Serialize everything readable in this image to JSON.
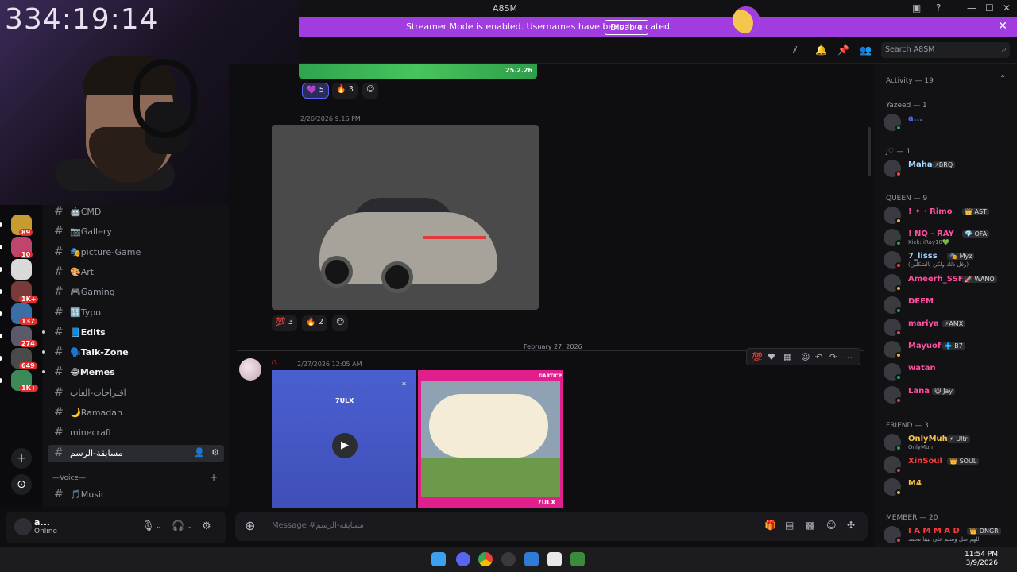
{
  "window": {
    "title": "A8SM",
    "controls": [
      "—",
      "☐",
      "✕"
    ]
  },
  "banner": {
    "text": "Streamer Mode is enabled. Usernames have been truncated.",
    "button": "Disable",
    "close": "✕"
  },
  "webcam": {
    "timer": "334:19:14"
  },
  "servers": [
    {
      "badge": "89",
      "color": "#c89a32"
    },
    {
      "badge": "10",
      "color": "#c1446c"
    },
    {
      "badge": "",
      "color": "#d9d9d9"
    },
    {
      "badge": "1K+",
      "color": "#7a3a3a"
    },
    {
      "badge": "137",
      "color": "#3a6ea5"
    },
    {
      "badge": "274",
      "color": "#5a5a6a"
    },
    {
      "badge": "649",
      "color": "#4a4a4a"
    },
    {
      "badge": "1K+",
      "color": "#3c8a5a"
    }
  ],
  "server_actions": {
    "add": "+",
    "discover": "⊙"
  },
  "channels": [
    {
      "name": "CMD",
      "emoji": "🤖",
      "bold": false
    },
    {
      "name": "Gallery",
      "emoji": "📷",
      "bold": false
    },
    {
      "name": "picture-Game",
      "emoji": "🎭",
      "bold": false
    },
    {
      "name": "Art",
      "emoji": "🎨",
      "bold": false
    },
    {
      "name": "Gaming",
      "emoji": "🎮",
      "bold": false
    },
    {
      "name": "Typo",
      "emoji": "🔢",
      "bold": false
    },
    {
      "name": "Edits",
      "emoji": "📘",
      "bold": true
    },
    {
      "name": "Talk-Zone",
      "emoji": "🗣️",
      "bold": true
    },
    {
      "name": "Memes",
      "emoji": "😂",
      "bold": true
    },
    {
      "name": "اقتراحات-العاب",
      "emoji": "",
      "bold": false
    },
    {
      "name": "Ramadan",
      "emoji": "🌙",
      "bold": false
    },
    {
      "name": "minecraft",
      "emoji": "",
      "bold": false
    },
    {
      "name": "مسابقة-الرسم",
      "emoji": "",
      "bold": false,
      "active": true
    }
  ],
  "voice_category": "—Voice—",
  "voice_channels": [
    {
      "name": "Music",
      "emoji": "🎵"
    }
  ],
  "user": {
    "name": "a...",
    "status": "Online"
  },
  "header": {
    "search_placeholder": "Search A8SM"
  },
  "messages": {
    "strip_date": "25.2.26",
    "reactions_top": [
      {
        "emoji": "💜",
        "count": "5"
      },
      {
        "emoji": "🔥",
        "count": "3"
      }
    ],
    "car_timestamp": "2/26/2026 9:16 PM",
    "reactions_car": [
      {
        "emoji": "💯",
        "count": "3"
      },
      {
        "emoji": "🔥",
        "count": "2"
      }
    ],
    "divider": "February 27, 2026",
    "author": "G...",
    "video_timestamp": "2/27/2026 12:05 AM",
    "video_label_left": "7ULX",
    "video_label_right": "7ULX",
    "video_game_label": "GARTICP"
  },
  "composer": {
    "placeholder": "Message #مسابقة-الرسم"
  },
  "members": {
    "activity": "Activity — 19",
    "sections": [
      {
        "title": "Yazeed — 1",
        "items": [
          {
            "name": "a...",
            "color": "#5865f2",
            "sub": "",
            "tag": ""
          }
        ]
      },
      {
        "title": "J♡ — 1",
        "items": [
          {
            "name": "Maha",
            "color": "#a9d8ff",
            "sub": "",
            "tag": "⚡BRQ"
          }
        ]
      },
      {
        "title": "QUEEN — 9",
        "items": [
          {
            "name": "! ✦ · Rimo",
            "color": "#ff4fa3",
            "sub": "",
            "tag": "👑 AST"
          },
          {
            "name": "! NQ - RAY",
            "color": "#ff4fa3",
            "sub": "Kick: iRay10💚",
            "tag": "💎 OFA"
          },
          {
            "name": "7_lisss",
            "color": "#9ad3ff",
            "sub": "(وقل ذلك ولكن بالشكلين)",
            "tag": "🎭 Myz"
          },
          {
            "name": "Ameerh_SSF",
            "color": "#ff4fa3",
            "sub": "",
            "tag": "🚀 WANO"
          },
          {
            "name": "DEEM",
            "color": "#ff4fa3",
            "sub": "",
            "tag": ""
          },
          {
            "name": "mariya",
            "color": "#ff4fa3",
            "sub": "",
            "tag": "⚡AMX"
          },
          {
            "name": "Mayuof",
            "color": "#ff4fa3",
            "sub": "",
            "tag": "💠 B7"
          },
          {
            "name": "watan",
            "color": "#ff4fa3",
            "sub": "",
            "tag": ""
          },
          {
            "name": "Lana",
            "color": "#ff4fa3",
            "sub": "",
            "tag": "😺 Jay"
          }
        ]
      },
      {
        "title": "FRIEND — 3",
        "items": [
          {
            "name": "OnlyMuh",
            "color": "#f2c14e",
            "sub": "OnlyMuh",
            "tag": "⚡ Ultr"
          },
          {
            "name": "XinSoul",
            "color": "#ff3b3b",
            "sub": "",
            "tag": "👑 SOUL"
          },
          {
            "name": "M4",
            "color": "#f2c14e",
            "sub": "",
            "tag": ""
          }
        ]
      },
      {
        "title": "MEMBER — 20",
        "items": [
          {
            "name": "I A M M A D",
            "color": "#ff3b3b",
            "sub": "اللهم صل وسلم على نبينا محمد",
            "tag": "👑 DNGR"
          }
        ]
      }
    ]
  },
  "taskbar": {
    "time": "11:54 PM",
    "date": "3/9/2026"
  },
  "colors": {
    "accent": "#a03ce0",
    "blurple": "#5865f2",
    "online": "#23a55a",
    "dnd": "#f23f43",
    "idle": "#f0b232"
  }
}
